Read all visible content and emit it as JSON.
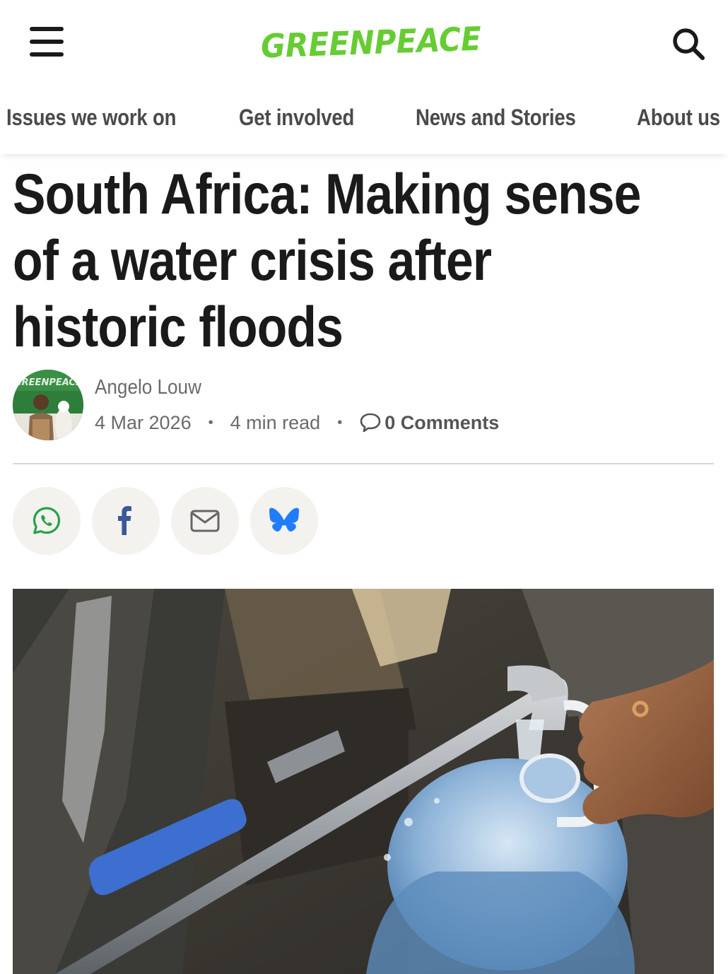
{
  "header": {
    "brand": "GREENPEACE",
    "brand_color": "#66cc33",
    "menu_icon": "hamburger-menu-icon",
    "search_icon": "search-icon"
  },
  "nav": {
    "items": [
      "Issues we work on",
      "Get involved",
      "News and Stories",
      "About us"
    ]
  },
  "article": {
    "title_lines": [
      "South Africa: Making sense",
      "of a water crisis after",
      "historic floods"
    ],
    "author": "Angelo Louw",
    "date": "4 Mar 2026",
    "read_time": "4 min read",
    "comments": "0 Comments",
    "separator": "•"
  },
  "share": {
    "buttons": [
      "whatsapp-icon",
      "facebook-icon",
      "email-icon",
      "bluesky-icon"
    ],
    "whatsapp_color": "#25a244",
    "facebook_color": "#3b5998",
    "bluesky_color": "#1f7cff"
  },
  "hero_image": {
    "subject": "water-tap-filling-bottle"
  }
}
